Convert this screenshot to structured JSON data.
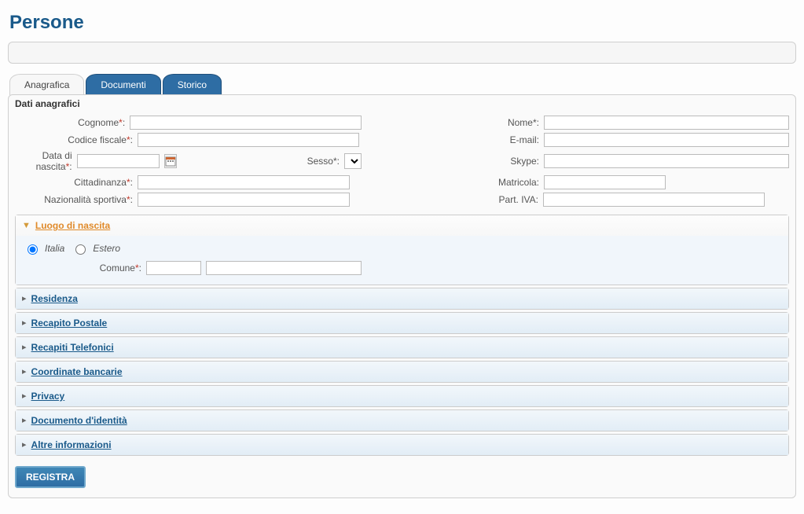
{
  "page": {
    "title": "Persone"
  },
  "tabs": {
    "anagrafica": "Anagrafica",
    "documenti": "Documenti",
    "storico": "Storico"
  },
  "anagrafici": {
    "legend": "Dati anagrafici",
    "labels": {
      "cognome": "Cognome",
      "nome": "Nome",
      "codice_fiscale": "Codice fiscale",
      "email": "E-mail:",
      "data_nascita": "Data di nascita",
      "sesso": "Sesso",
      "skype": "Skype:",
      "cittadinanza": "Cittadinanza",
      "matricola": "Matricola:",
      "nazionalita_sportiva": "Nazionalità sportiva",
      "part_iva": "Part. IVA:"
    },
    "values": {
      "cognome": "",
      "nome": "",
      "codice_fiscale": "",
      "email": "",
      "data_nascita": "",
      "sesso": "",
      "skype": "",
      "cittadinanza": "",
      "matricola": "",
      "nazionalita_sportiva": "",
      "part_iva": ""
    },
    "suffix_required": "*:",
    "suffix_plain": ":"
  },
  "luogo_nascita": {
    "title": "Luogo di nascita",
    "radio_italia": "Italia",
    "radio_estero": "Estero",
    "comune_label": "Comune",
    "comune_a": "",
    "comune_b": ""
  },
  "sections": {
    "residenza": "Residenza",
    "recapito_postale": "Recapito Postale",
    "recapiti_telefonici": "Recapiti Telefonici",
    "coordinate_bancarie": "Coordinate bancarie",
    "privacy": "Privacy",
    "documento_identita": "Documento d'identità",
    "altre_informazioni": "Altre informazioni"
  },
  "buttons": {
    "registra": "REGISTRA"
  }
}
